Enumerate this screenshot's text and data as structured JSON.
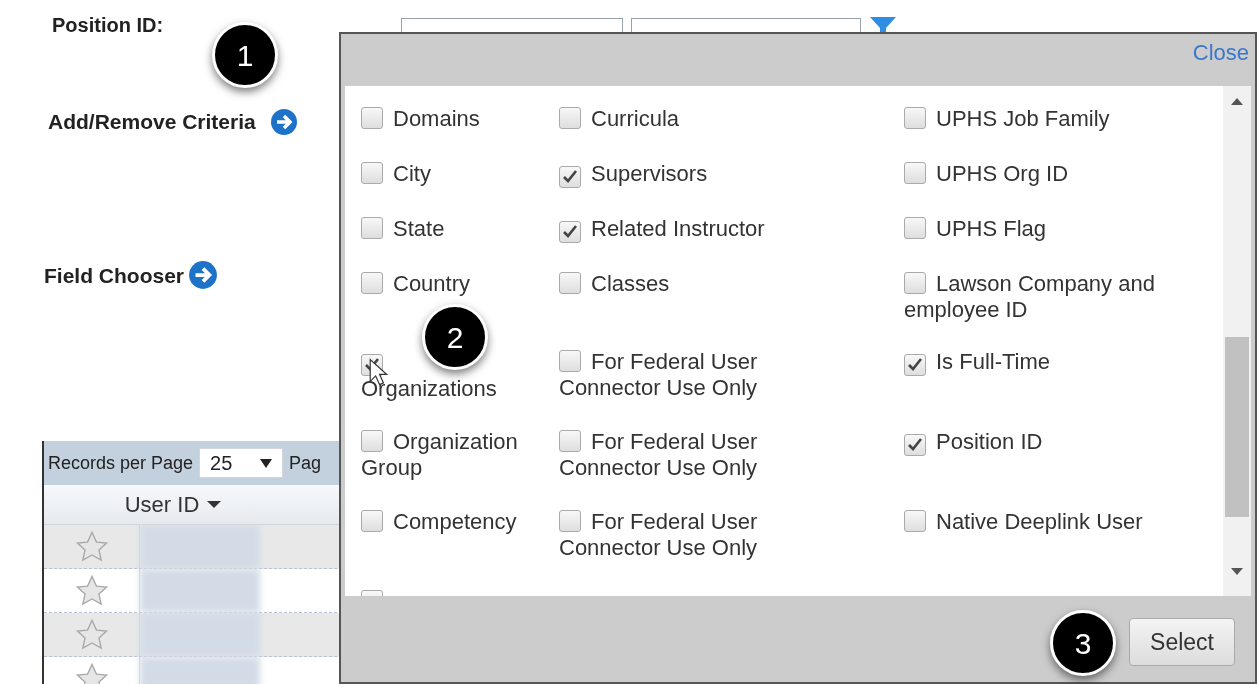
{
  "page": {
    "position_label": "Position ID:",
    "add_remove_link": "Add/Remove Criteria",
    "field_chooser_link": "Field Chooser"
  },
  "table": {
    "records_label": "Records per Page",
    "records_value": "25",
    "page_label_cut": "Pag",
    "column": "User ID",
    "rows": [
      {
        "shaded": true
      },
      {
        "shaded": false
      },
      {
        "shaded": true
      },
      {
        "shaded": false
      }
    ]
  },
  "dialog": {
    "close": "Close",
    "select_button": "Select",
    "columns": [
      [
        {
          "label": "Domains",
          "checked": false
        },
        {
          "label": "City",
          "checked": false
        },
        {
          "label": "State",
          "checked": false
        },
        {
          "label": "Country",
          "checked": false
        },
        {
          "label": "Organizations",
          "checked": true
        },
        {
          "label": "Organization Group",
          "checked": false
        },
        {
          "label": "Competency",
          "checked": false
        },
        {
          "checked": false
        }
      ],
      [
        {
          "label": "Curricula",
          "checked": false
        },
        {
          "label": "Supervisors",
          "checked": true
        },
        {
          "label": "Related Instructor",
          "checked": true
        },
        {
          "label": "Classes",
          "checked": false
        },
        {
          "label": "For Federal User Connector Use Only",
          "checked": false
        },
        {
          "label": "For Federal User Connector Use Only",
          "checked": false
        },
        {
          "label": "For Federal User Connector Use Only",
          "checked": false
        }
      ],
      [
        {
          "label": "UPHS Job Family",
          "checked": false
        },
        {
          "label": "UPHS Org ID",
          "checked": false
        },
        {
          "label": "UPHS Flag",
          "checked": false
        },
        {
          "label": "Lawson Company and employee ID",
          "checked": false
        },
        {
          "label": "Is Full-Time",
          "checked": true
        },
        {
          "label": "Position ID",
          "checked": true
        },
        {
          "label": "Native Deeplink User",
          "checked": false
        }
      ]
    ]
  },
  "callouts": [
    "1",
    "2",
    "3"
  ]
}
